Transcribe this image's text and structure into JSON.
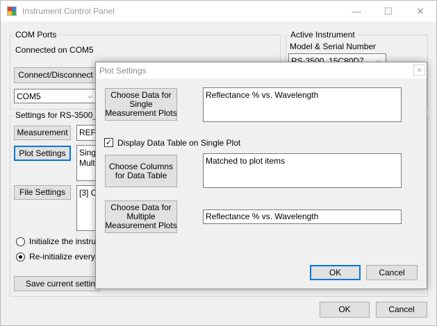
{
  "window": {
    "title": "Instrument Control Panel",
    "minimize_glyph": "—",
    "maximize_glyph": "☐",
    "close_glyph": "✕"
  },
  "com_ports": {
    "group_label": "COM Ports",
    "status": "Connected on COM5",
    "connect_button": "Connect/Disconnect",
    "port_selected": "COM5"
  },
  "active_instrument": {
    "group_label": "Active Instrument",
    "model_label": "Model & Serial Number",
    "model_selected": "RS-3500_15C80D7"
  },
  "settings": {
    "group_label": "Settings for RS-3500_15",
    "measurement_button": "Measurement",
    "measurement_value": "REFL",
    "plot_settings_button": "Plot Settings",
    "plot_value_line1": "Single",
    "plot_value_line2": "Multip",
    "file_settings_button": "File Settings",
    "file_value": "[3] Co",
    "radio_init": "Initialize the instrume",
    "radio_reinit": "Re-initialize every tim",
    "save_button": "Save current settings"
  },
  "footer": {
    "ok": "OK",
    "cancel": "Cancel"
  },
  "dialog": {
    "title": "Plot Settings",
    "close_glyph": "✕",
    "single_button": [
      "Choose Data for",
      "Single",
      "Measurement Plots"
    ],
    "single_value": "Reflectance % vs. Wavelength",
    "display_table_checkbox": "Display Data Table on Single Plot",
    "columns_button": [
      "Choose Columns",
      "for Data Table"
    ],
    "columns_value": "Matched to plot items",
    "multiple_button": [
      "Choose Data for",
      "Multiple",
      "Measurement Plots"
    ],
    "multiple_value": "Reflectance % vs. Wavelength",
    "ok": "OK",
    "cancel": "Cancel"
  }
}
